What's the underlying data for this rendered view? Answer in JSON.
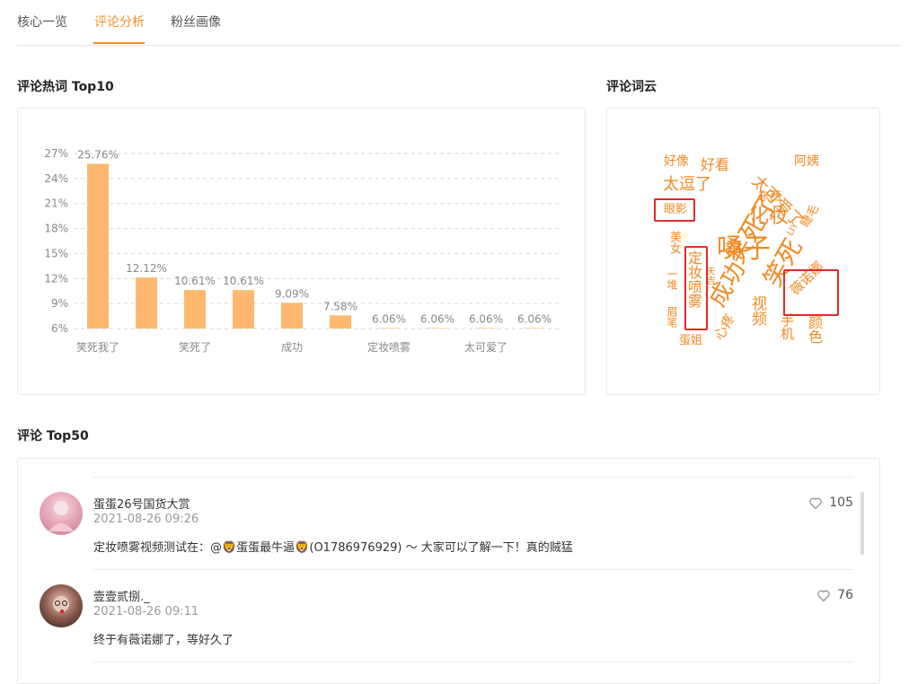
{
  "tabs": [
    {
      "label": "核心一览"
    },
    {
      "label": "评论分析"
    },
    {
      "label": "粉丝画像"
    }
  ],
  "active_tab": "评论分析",
  "sections": {
    "hot_words_title": "评论热词 Top10",
    "word_cloud_title": "评论词云",
    "top_comments_title": "评论 Top50"
  },
  "chart_data": {
    "type": "bar",
    "categories": [
      "笑死我了",
      "",
      "笑死了",
      "",
      "成功",
      "",
      "定妆喷雾",
      "",
      "太可爱了",
      ""
    ],
    "x_tick_labels": [
      "笑死我了",
      "笑死了",
      "成功",
      "定妆喷雾",
      "太可爱了"
    ],
    "values": [
      25.76,
      12.12,
      10.61,
      10.61,
      9.09,
      7.58,
      6.06,
      6.06,
      6.06,
      6.06
    ],
    "data_labels": [
      "25.76%",
      "12.12%",
      "10.61%",
      "10.61%",
      "9.09%",
      "7.58%",
      "6.06%",
      "6.06%",
      "6.06%",
      "6.06%"
    ],
    "y_ticks": [
      "6%",
      "9%",
      "12%",
      "15%",
      "18%",
      "21%",
      "24%",
      "27%"
    ],
    "ylim": [
      6,
      27
    ],
    "grid": true,
    "bar_color": "#ffb86e"
  },
  "word_cloud": {
    "words": [
      "好像",
      "好看",
      "阿姨",
      "太可爱了",
      "太逗了",
      "东西",
      "笑死了",
      "眼影",
      "化妆",
      "嗓子",
      "睫毛",
      "美女",
      "定妆喷雾",
      "成功",
      "笑死",
      "薇诺娜",
      "视频",
      "一堆",
      "手机",
      "颜色",
      "蛋姐",
      "心疼",
      "眉笔",
      "天吉",
      "LIY"
    ],
    "color": "#f08a24",
    "highlight_color": "#e02a2a"
  },
  "comments": [
    {
      "name": "蛋蛋26号国货大赏",
      "time": "2021-08-26 09:26",
      "text": "定妆喷雾视频测试在：@🦁蛋蛋最牛逼🦁(O1786976929) ～ 大家可以了解一下！真的贼猛",
      "likes": "105"
    },
    {
      "name": "壹壹贰捌._",
      "time": "2021-08-26 09:11",
      "text": "终于有薇诺娜了，等好久了",
      "likes": "76"
    }
  ]
}
